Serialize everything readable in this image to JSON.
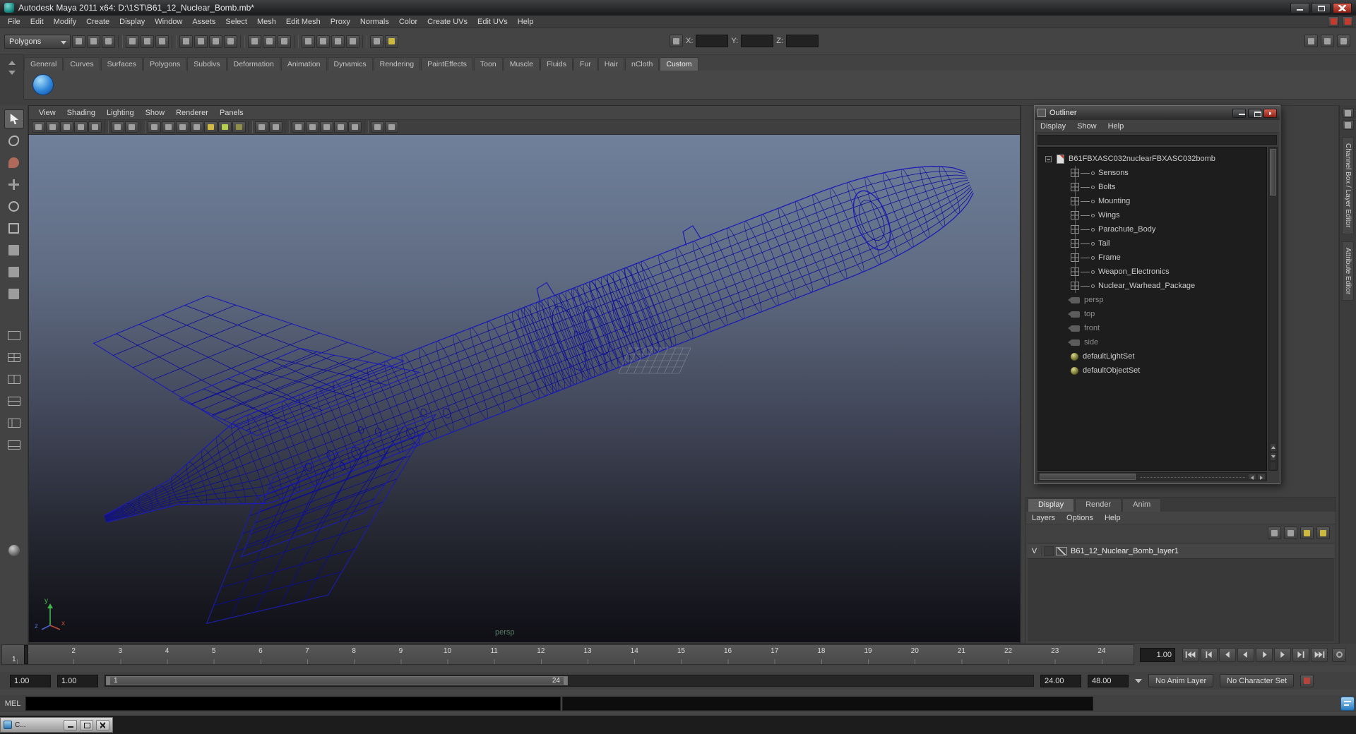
{
  "title_bar": {
    "title": "Autodesk Maya 2011 x64: D:\\1ST\\B61_12_Nuclear_Bomb.mb*"
  },
  "menu_bar": {
    "items": [
      "File",
      "Edit",
      "Modify",
      "Create",
      "Display",
      "Window",
      "Assets",
      "Select",
      "Mesh",
      "Edit Mesh",
      "Proxy",
      "Normals",
      "Color",
      "Create UVs",
      "Edit UVs",
      "Help"
    ],
    "right_icons": [
      {
        "name": "app-badge-icon",
        "color": "#c23b2e"
      },
      {
        "name": "panel-close-icon",
        "color": "#c23b2e"
      }
    ]
  },
  "status_line": {
    "menu_set": "Polygons",
    "icons": [
      "new-scene-icon",
      "open-scene-icon",
      "save-scene-icon",
      "|",
      "select-hierarchy-icon",
      "select-object-icon",
      "select-component-icon",
      "|",
      "snap-grid-icon",
      "snap-curve-icon",
      "snap-point-icon",
      "snap-view-plane-icon",
      "|",
      "snap-surface-icon",
      "make-live-icon",
      "construction-history-icon",
      "|",
      "render-view-icon",
      "render-current-frame-icon",
      "ipr-render-icon",
      "render-settings-icon",
      "|",
      "quick-help-icon",
      {
        "name": "hotkey-icon",
        "color": "#cdb93e"
      }
    ],
    "select_by_name_icon": "select-by-name-icon",
    "x_label": "X:",
    "x_value": "",
    "y_label": "Y:",
    "y_value": "",
    "z_label": "Z:",
    "z_value": "",
    "right_icons": [
      "raise-panels-icon",
      "pane-layout-icon",
      "attribute-editor-toggle-icon"
    ]
  },
  "shelf": {
    "tabs": [
      "General",
      "Curves",
      "Surfaces",
      "Polygons",
      "Subdivs",
      "Deformation",
      "Animation",
      "Dynamics",
      "Rendering",
      "PaintEffects",
      "Toon",
      "Muscle",
      "Fluids",
      "Fur",
      "Hair",
      "nCloth",
      "Custom"
    ],
    "active_tab": "Custom"
  },
  "toolbox": {
    "tools": [
      "select-tool",
      "lasso-select-tool",
      "paint-select-tool",
      "move-tool",
      "rotate-tool",
      "scale-tool",
      "universal-manipulator-tool",
      "soft-modification-tool",
      "show-manipulator-tool"
    ],
    "active_tool": "select-tool",
    "layouts": [
      "single-pane-layout",
      "four-pane-layout",
      "two-pane-side-layout",
      "two-pane-stacked-layout",
      "persp-outliner-layout",
      "persp-graph-layout"
    ],
    "extra": [
      "sphere-layout-icon"
    ]
  },
  "viewport": {
    "menus": [
      "View",
      "Shading",
      "Lighting",
      "Show",
      "Renderer",
      "Panels"
    ],
    "toolbar_icons": [
      "select-camera-icon",
      "lock-camera-icon",
      "camera-attributes-icon",
      "bookmark-icon",
      "image-plane-icon",
      "|",
      "two-d-pan-zoom-icon",
      "grease-pencil-icon",
      "|",
      "wireframe-display-icon",
      "shaded-display-icon",
      "textured-display-icon",
      "use-all-lights-icon",
      {
        "name": "default-lighting-icon",
        "color": "#d2bb45"
      },
      {
        "name": "lighting-icon",
        "color": "#b7cf4e"
      },
      {
        "name": "shadows-icon",
        "color": "#8f8f4a"
      },
      "|",
      "xray-icon",
      "isolate-select-icon",
      "|",
      "field-chart-icon",
      "resolution-gate-icon",
      "gate-mask-icon",
      "safe-action-icon",
      "safe-title-icon",
      "|",
      "scene-view-icon",
      "render-globals-icon"
    ],
    "camera_label": "persp",
    "axis": {
      "x": "x",
      "y": "y",
      "z": "z"
    }
  },
  "outliner": {
    "title": "Outliner",
    "menus": [
      "Display",
      "Show",
      "Help"
    ],
    "filter_value": "",
    "items": [
      {
        "label": "B61FBXASC032nuclearFBXASC032bomb",
        "type": "group"
      },
      {
        "label": "Sensons",
        "type": "mesh"
      },
      {
        "label": "Bolts",
        "type": "mesh"
      },
      {
        "label": "Mounting",
        "type": "mesh"
      },
      {
        "label": "Wings",
        "type": "mesh"
      },
      {
        "label": "Parachute_Body",
        "type": "mesh"
      },
      {
        "label": "Tail",
        "type": "mesh"
      },
      {
        "label": "Frame",
        "type": "mesh"
      },
      {
        "label": "Weapon_Electronics",
        "type": "mesh"
      },
      {
        "label": "Nuclear_Warhead_Package",
        "type": "mesh"
      },
      {
        "label": "persp",
        "type": "camera"
      },
      {
        "label": "top",
        "type": "camera"
      },
      {
        "label": "front",
        "type": "camera"
      },
      {
        "label": "side",
        "type": "camera"
      },
      {
        "label": "defaultLightSet",
        "type": "set"
      },
      {
        "label": "defaultObjectSet",
        "type": "set"
      }
    ]
  },
  "dock": {
    "icons": [
      "dock-toggle-icon",
      "dock-pin-icon"
    ],
    "tabs": [
      "Channel Box / Layer Editor",
      "Attribute Editor"
    ]
  },
  "layer_editor": {
    "tabs": [
      "Display",
      "Render",
      "Anim"
    ],
    "active_tab": "Display",
    "menus": [
      "Layers",
      "Options",
      "Help"
    ],
    "toolbar_icons": [
      {
        "name": "layer-move-up-icon"
      },
      {
        "name": "layer-move-down-icon"
      },
      {
        "name": "new-empty-layer-icon",
        "color": "#cdb93e"
      },
      {
        "name": "new-layer-from-selection-icon",
        "color": "#cdb93e"
      }
    ],
    "layers": [
      {
        "visibility_label": "V",
        "name": "B61_12_Nuclear_Bomb_layer1"
      }
    ]
  },
  "time_slider": {
    "frame_labels": [
      "1",
      "2",
      "3",
      "4",
      "5",
      "6",
      "7",
      "8",
      "9",
      "10",
      "11",
      "12",
      "13",
      "14",
      "15",
      "16",
      "17",
      "18",
      "19",
      "20",
      "21",
      "22",
      "23",
      "24"
    ],
    "current_frame": "1",
    "current_time": "1.00",
    "playback_icons": [
      "go-to-start",
      "step-back-frame",
      "step-back-key",
      "play-backward",
      "play-forward",
      "step-forward-key",
      "step-forward-frame",
      "go-to-end"
    ],
    "preferences_icon": "animation-preferences-icon"
  },
  "range_slider": {
    "anim_start": "1.00",
    "playback_start": "1.00",
    "range_start": "1",
    "range_end": "24",
    "playback_end": "24.00",
    "anim_end": "48.00",
    "anim_layer": "No Anim Layer",
    "character_set": "No Character Set",
    "right_icons": [
      {
        "name": "auto-keyframe-icon",
        "color": "#b8433a"
      }
    ]
  },
  "command_line": {
    "label": "MEL",
    "input_value": ""
  },
  "help_line": {
    "minimized_window_title": "C..."
  }
}
